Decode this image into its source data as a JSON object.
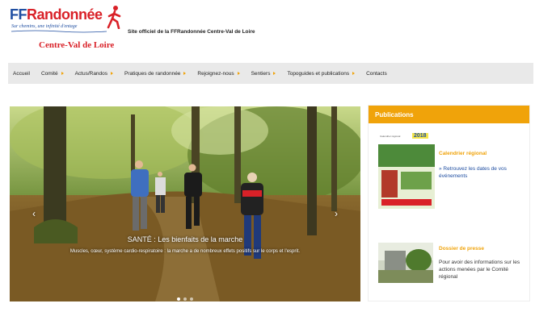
{
  "logo": {
    "brand_ff": "FF",
    "brand_rest": "Randonnée",
    "tagline": "Sur chemins, une infinité d'entage",
    "region": "Centre-Val de Loire"
  },
  "header": {
    "site_description": "Site officiel de la FFRandonnée Centre-Val de Loire"
  },
  "nav": {
    "items": [
      {
        "label": "Accueil",
        "has_submenu": false
      },
      {
        "label": "Comité",
        "has_submenu": true
      },
      {
        "label": "Actus/Randos",
        "has_submenu": true
      },
      {
        "label": "Pratiques de randonnée",
        "has_submenu": true
      },
      {
        "label": "Rejoignez-nous",
        "has_submenu": true
      },
      {
        "label": "Sentiers",
        "has_submenu": true
      },
      {
        "label": "Topoguides et publications",
        "has_submenu": true
      },
      {
        "label": "Contacts",
        "has_submenu": false
      }
    ]
  },
  "hero": {
    "title": "SANTÉ : Les bienfaits de la marche",
    "text": "Muscles, cœur, système cardio-respiratoire : la marche a de nombreux effets positifs sur le corps et l'esprit.",
    "prev_arrow": "‹",
    "next_arrow": "›"
  },
  "sidebar": {
    "heading": "Publications",
    "cards": [
      {
        "thumb_label": "2018",
        "thumb_caption": "Calendrier régional",
        "title": "Calendrier régional",
        "link_text": "» Retrouvez les dates de vos événements"
      },
      {
        "title": "Dossier de presse",
        "text": "Pour avoir des informations sur les actions menées par le Comité régional"
      }
    ]
  },
  "colors": {
    "brand_red": "#d92128",
    "brand_blue": "#1f4ea1",
    "accent_orange": "#f0a30a",
    "nav_bg": "#e9e9e9"
  }
}
